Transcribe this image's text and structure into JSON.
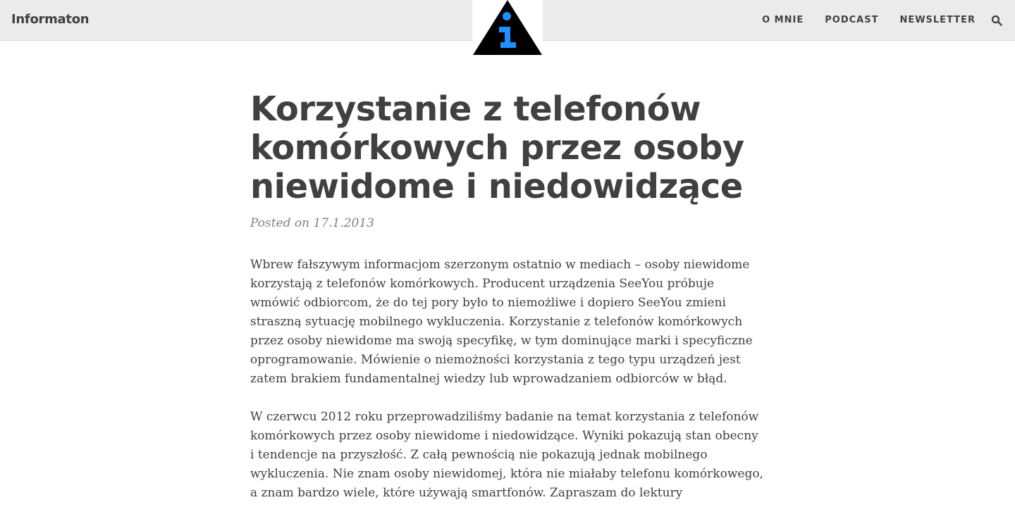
{
  "header": {
    "brand": "Informaton",
    "nav": [
      {
        "label": "O MNIE"
      },
      {
        "label": "PODCAST"
      },
      {
        "label": "NEWSLETTER"
      }
    ]
  },
  "colors": {
    "logo_triangle": "#000000",
    "logo_glyph": "#1e90ff",
    "navbar_bg": "#ebebeb"
  },
  "post": {
    "title": "Korzystanie z telefonów komórkowych przez osoby niewidome i niedowidzące",
    "meta": "Posted on 17.1.2013",
    "paragraphs": [
      "Wbrew fałszywym informacjom szerzonym ostatnio w mediach – osoby niewidome korzystają z telefonów komórkowych. Producent urządzenia SeeYou próbuje wmówić odbiorcom, że do tej pory było to niemożliwe i dopiero SeeYou zmieni straszną sytuację mobilnego wykluczenia. Korzystanie z telefonów komórkowych przez osoby niewidome ma swoją specyfikę, w tym dominujące marki i specyficzne oprogramowanie. Mówienie o niemożności korzystania z tego typu urządzeń jest zatem brakiem fundamentalnej wiedzy lub wprowadzaniem odbiorców w błąd.",
      "W czerwcu 2012 roku przeprowadziliśmy badanie na temat korzystania z telefonów komórkowych przez osoby niewidome i niedowidzące. Wyniki pokazują stan obecny i tendencje na przyszłość. Z całą pewnością nie pokazują jednak mobilnego wykluczenia. Nie znam osoby niewidomej, która nie miałaby telefonu komórkowego, a znam bardzo wiele, które używają smartfonów. Zapraszam do lektury"
    ]
  }
}
